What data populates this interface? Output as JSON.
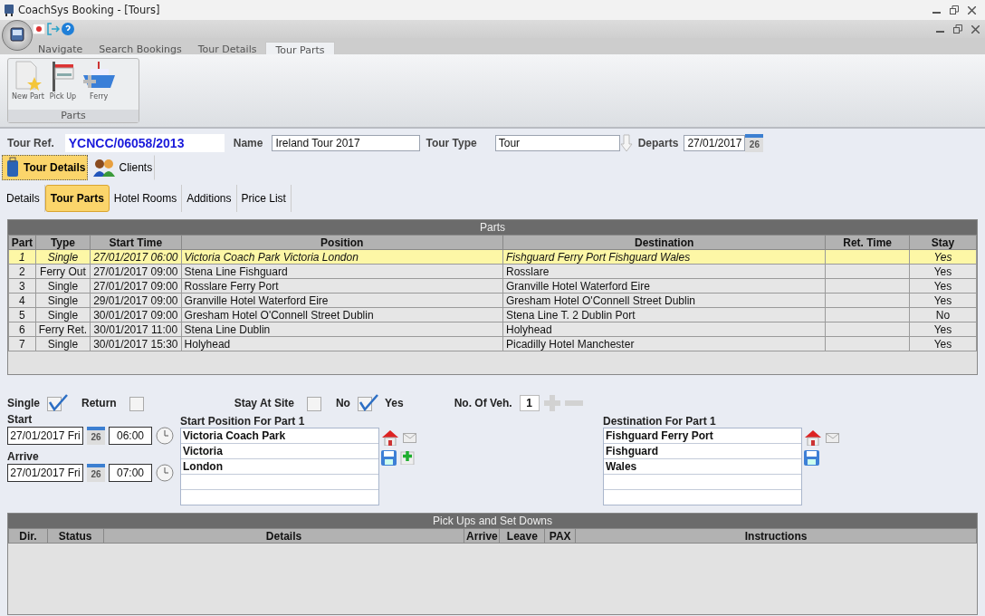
{
  "window": {
    "title": "CoachSys Booking - [Tours]"
  },
  "ribbon_tabs": [
    {
      "label": "Navigate",
      "selected": false
    },
    {
      "label": "Search Bookings",
      "selected": false
    },
    {
      "label": "Tour Details",
      "selected": false
    },
    {
      "label": "Tour Parts",
      "selected": true
    }
  ],
  "ribbon_group": {
    "title": "Parts",
    "buttons": [
      {
        "label": "New Part",
        "kind": "new"
      },
      {
        "label": "Pick Up",
        "kind": "pickup"
      },
      {
        "label": "Ferry",
        "kind": "ferry"
      }
    ]
  },
  "tour": {
    "ref_label": "Tour Ref.",
    "ref_value": "YCNCC/06058/2013",
    "name_label": "Name",
    "name_value": "Ireland Tour 2017",
    "type_label": "Tour Type",
    "type_value": "Tour",
    "departs_label": "Departs",
    "departs_value": "27/01/2017",
    "calendar_day": "26"
  },
  "main_tabs": [
    {
      "label": "Tour Details",
      "selected": true,
      "kind": "details"
    },
    {
      "label": "Clients",
      "selected": false,
      "kind": "clients"
    }
  ],
  "sub_tabs": [
    {
      "label": "Details",
      "selected": false
    },
    {
      "label": "Tour Parts",
      "selected": true
    },
    {
      "label": "Hotel Rooms",
      "selected": false
    },
    {
      "label": "Additions",
      "selected": false
    },
    {
      "label": "Price List",
      "selected": false
    }
  ],
  "parts_grid": {
    "title": "Parts",
    "columns": [
      "Part",
      "Type",
      "Start Time",
      "Position",
      "Destination",
      "Ret. Time",
      "Stay"
    ],
    "rows": [
      {
        "selected": true,
        "cells": [
          "1",
          "Single",
          "27/01/2017 06:00",
          "Victoria Coach Park Victoria London",
          "Fishguard Ferry Port Fishguard Wales",
          "",
          "Yes"
        ]
      },
      {
        "selected": false,
        "cells": [
          "2",
          "Ferry Out",
          "27/01/2017 09:00",
          "Stena Line Fishguard",
          "Rosslare",
          "",
          "Yes"
        ]
      },
      {
        "selected": false,
        "cells": [
          "3",
          "Single",
          "27/01/2017 09:00",
          "Rosslare Ferry Port",
          "Granville Hotel Waterford Eire",
          "",
          "Yes"
        ]
      },
      {
        "selected": false,
        "cells": [
          "4",
          "Single",
          "29/01/2017 09:00",
          "Granville Hotel Waterford Eire",
          "Gresham Hotel O'Connell Street Dublin",
          "",
          "Yes"
        ]
      },
      {
        "selected": false,
        "cells": [
          "5",
          "Single",
          "30/01/2017 09:00",
          "Gresham Hotel O'Connell Street Dublin",
          "Stena Line T. 2 Dublin Port",
          "",
          "No"
        ]
      },
      {
        "selected": false,
        "cells": [
          "6",
          "Ferry Ret.",
          "30/01/2017 11:00",
          "Stena Line Dublin",
          "Holyhead",
          "",
          "Yes"
        ]
      },
      {
        "selected": false,
        "cells": [
          "7",
          "Single",
          "30/01/2017 15:30",
          "Holyhead",
          "Picadilly Hotel Manchester",
          "",
          "Yes"
        ]
      }
    ]
  },
  "options": {
    "single_label": "Single",
    "single_checked": true,
    "return_label": "Return",
    "return_checked": false,
    "stay_label": "Stay At Site",
    "no_label": "No",
    "no_checked": false,
    "yes_label": "Yes",
    "yes_checked": true,
    "vehicles_label": "No. Of Veh.",
    "vehicles_value": "1"
  },
  "start": {
    "label": "Start",
    "date": "27/01/2017 Fri",
    "calendar_day": "26",
    "time": "06:00"
  },
  "arrive": {
    "label": "Arrive",
    "date": "27/01/2017 Fri",
    "calendar_day": "26",
    "time": "07:00"
  },
  "start_position": {
    "title": "Start Position For Part 1",
    "lines": [
      "Victoria Coach Park",
      "Victoria",
      "London"
    ]
  },
  "destination": {
    "title": "Destination For Part 1",
    "lines": [
      "Fishguard Ferry Port",
      "Fishguard",
      "Wales"
    ]
  },
  "pickups_grid": {
    "title": "Pick Ups and Set Downs",
    "columns": [
      "Dir.",
      "Status",
      "Details",
      "Arrive",
      "Leave",
      "PAX",
      "Instructions"
    ]
  }
}
